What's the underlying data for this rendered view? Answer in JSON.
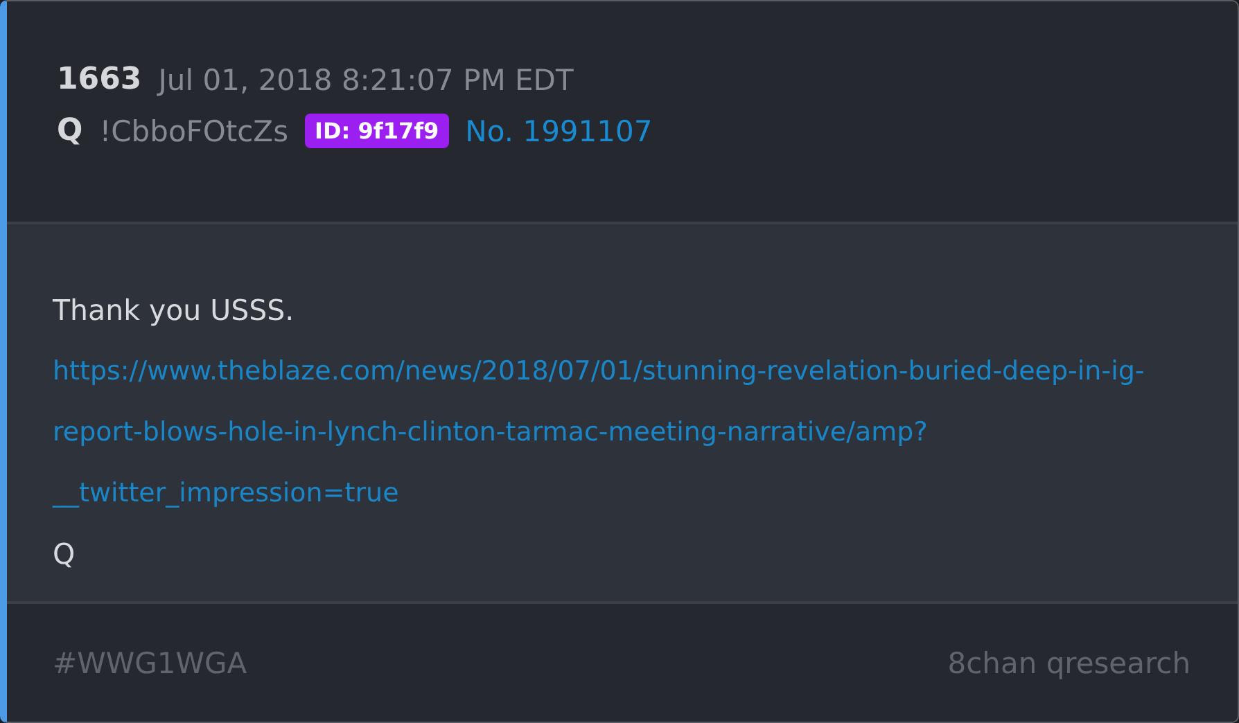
{
  "post": {
    "number": "1663",
    "date": "Jul 01, 2018 8:21:07 PM EDT",
    "author": "Q",
    "tripcode": "!CbboFOtcZs",
    "id_badge": "ID: 9f17f9",
    "post_no": "No. 1991107"
  },
  "body": [
    {
      "kind": "text",
      "text": "Thank you USSS."
    },
    {
      "kind": "link",
      "text": "https://www.theblaze.com/news/2018/07/01/stunning-revelation-buried-deep-in-ig-report-blows-hole-in-lynch-clinton-tarmac-meeting-narrative/amp?__twitter_impression=true"
    },
    {
      "kind": "text",
      "text": "Q"
    }
  ],
  "footer": {
    "hashtag": "#WWG1WGA",
    "source": "8chan qresearch"
  }
}
